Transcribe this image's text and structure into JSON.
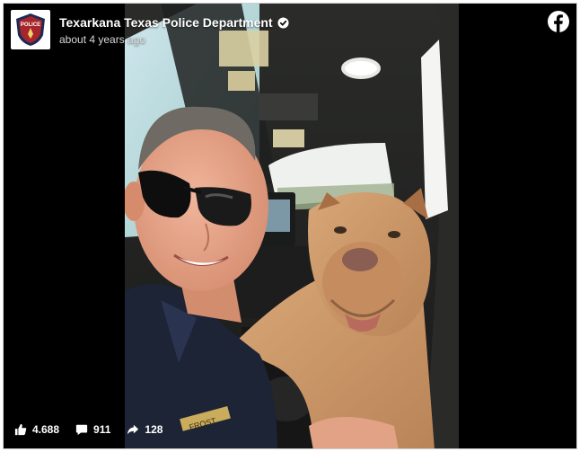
{
  "post": {
    "page_name": "Texarkana Texas Police Department",
    "timestamp": "about 4 years ago",
    "avatar_badge_text": "POLICE",
    "verified": true
  },
  "icons": {
    "verified": "verified-badge-icon",
    "facebook": "facebook-logo-icon",
    "like": "like-thumb-icon",
    "comment": "comment-bubble-icon",
    "share": "share-arrow-icon"
  },
  "stats": {
    "likes": "4.688",
    "comments": "911",
    "shares": "128"
  },
  "photo": {
    "name_tag": "FROST"
  },
  "colors": {
    "embed_background": "#000000",
    "text_primary": "#ffffff",
    "text_secondary": "#d8d8d8",
    "facebook_blue": "#ffffff"
  }
}
